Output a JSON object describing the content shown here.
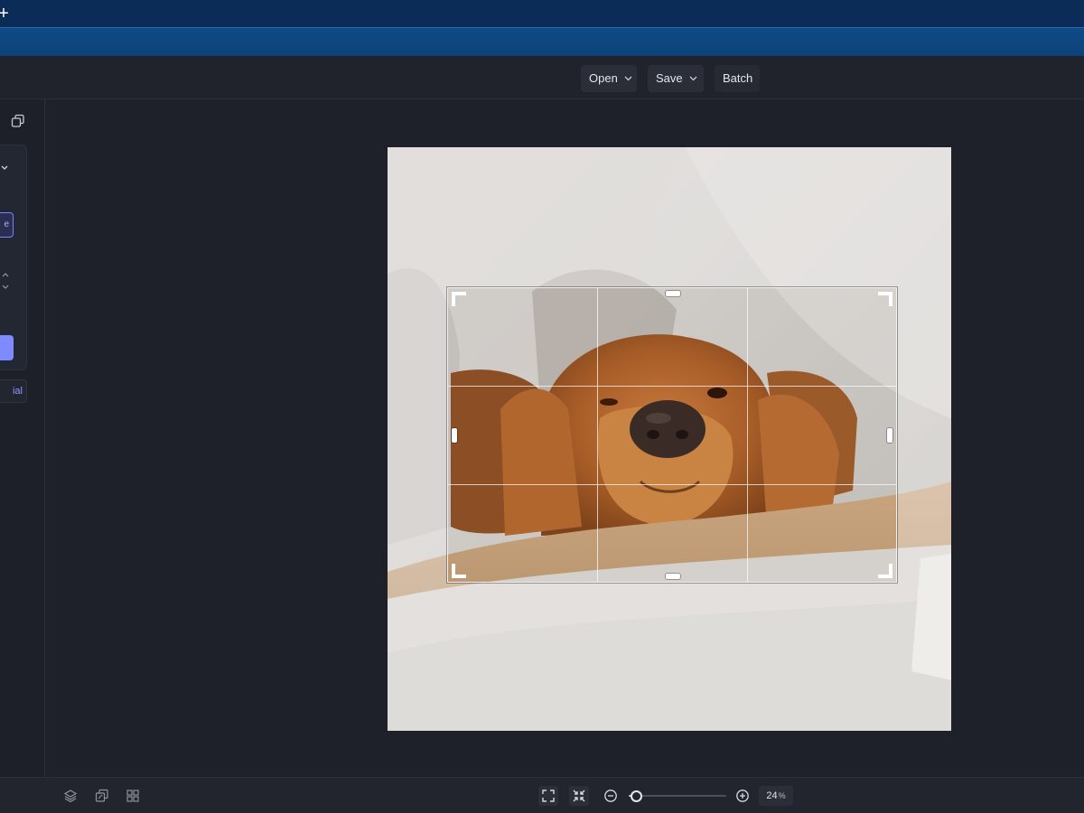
{
  "browser": {
    "new_tab_glyph": "+"
  },
  "header": {
    "open_label": "Open",
    "save_label": "Save",
    "batch_label": "Batch",
    "dropdown_icon": "chevron-down-icon"
  },
  "side_panel": {
    "top_icon": "copy-icon",
    "outlined_button_fragment": "e",
    "link_button_fragment": "ial"
  },
  "canvas": {
    "image_subject": "golden-retriever-photo",
    "crop_tool": {
      "grid": "rule-of-thirds"
    }
  },
  "bottom_bar": {
    "left_icons": [
      "layers-icon",
      "duplicate-icon",
      "grid-view-icon"
    ],
    "view_icons": [
      "fit-screen-icon",
      "actual-size-icon"
    ],
    "zoom": {
      "value": "24",
      "unit": "%",
      "slider_fraction": 0.07
    }
  },
  "colors": {
    "accent": "#7e8bff",
    "background": "#1f222b",
    "browser_toolbar": "#0f4a87"
  }
}
